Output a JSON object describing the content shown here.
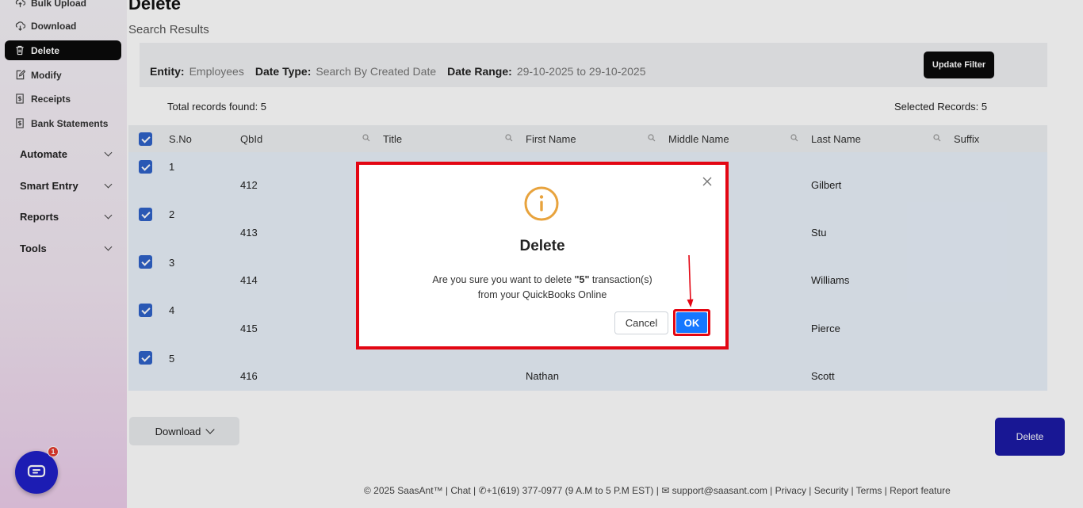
{
  "sidebar": {
    "items": [
      {
        "label": "Bulk Upload",
        "icon": "upload-icon"
      },
      {
        "label": "Download",
        "icon": "download-icon"
      },
      {
        "label": "Delete",
        "icon": "trash-icon",
        "active": true
      },
      {
        "label": "Modify",
        "icon": "edit-icon"
      },
      {
        "label": "Receipts",
        "icon": "receipt-icon"
      },
      {
        "label": "Bank Statements",
        "icon": "bank-icon"
      }
    ],
    "groups": [
      "Automate",
      "Smart Entry",
      "Reports",
      "Tools"
    ]
  },
  "page": {
    "title": "Delete",
    "subtitle": "Search Results"
  },
  "filter": {
    "entity_label": "Entity:",
    "entity_value": "Employees",
    "date_type_label": "Date Type:",
    "date_type_value": "Search By Created Date",
    "date_range_label": "Date Range:",
    "date_range_value": "29-10-2025 to 29-10-2025",
    "update_button": "Update Filter"
  },
  "summary": {
    "total": "Total records found: 5",
    "selected": "Selected Records: 5"
  },
  "table": {
    "headers": [
      "S.No",
      "QbId",
      "Title",
      "First Name",
      "Middle Name",
      "Last Name",
      "Suffix"
    ],
    "rows": [
      {
        "sno": "1",
        "qbid": "412",
        "first": "",
        "last": "Gilbert"
      },
      {
        "sno": "2",
        "qbid": "413",
        "first": "",
        "last": "Stu"
      },
      {
        "sno": "3",
        "qbid": "414",
        "first": "",
        "last": "Williams"
      },
      {
        "sno": "4",
        "qbid": "415",
        "first": "",
        "last": "Pierce"
      },
      {
        "sno": "5",
        "qbid": "416",
        "first": "Nathan",
        "last": "Scott"
      }
    ]
  },
  "actions": {
    "download": "Download",
    "delete": "Delete"
  },
  "footer": {
    "text": "© 2025 SaasAnt™ | Chat  |  ✆+1(619) 377-0977 (9 A.M to 5 P.M EST)  |  ✉ support@saasant.com | Privacy  | Security  | Terms  | Report feature"
  },
  "chat": {
    "badge": "1"
  },
  "modal": {
    "title": "Delete",
    "message_pre": "Are you sure you want to delete ",
    "message_count": "\"5\"",
    "message_post": " transaction(s)",
    "message_line2": "from your QuickBooks Online",
    "cancel": "Cancel",
    "ok": "OK"
  },
  "colors": {
    "accent_blue": "#1677ff",
    "delete_button": "#1b1aa5",
    "highlight_red": "#e30613",
    "checkbox_blue": "#2f62c9",
    "warning_orange": "#e8a33d"
  }
}
